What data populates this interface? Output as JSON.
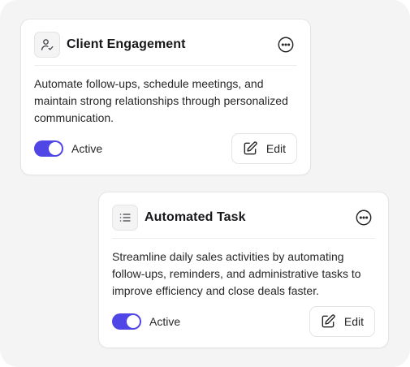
{
  "colors": {
    "accent": "#4f46e5",
    "background": "#f4f4f5",
    "card": "#ffffff",
    "border": "#e4e4e7"
  },
  "cards": [
    {
      "icon": "user-check-icon",
      "title": "Client Engagement",
      "description": "Automate follow-ups, schedule meetings, and maintain strong relationships through personalized communication.",
      "toggle_label": "Active",
      "toggle_on": true,
      "edit_label": "Edit"
    },
    {
      "icon": "list-icon",
      "title": "Automated Task",
      "description": "Streamline daily sales activities by automating follow-ups, reminders, and administrative tasks to improve efficiency and close deals faster.",
      "toggle_label": "Active",
      "toggle_on": true,
      "edit_label": "Edit"
    }
  ]
}
